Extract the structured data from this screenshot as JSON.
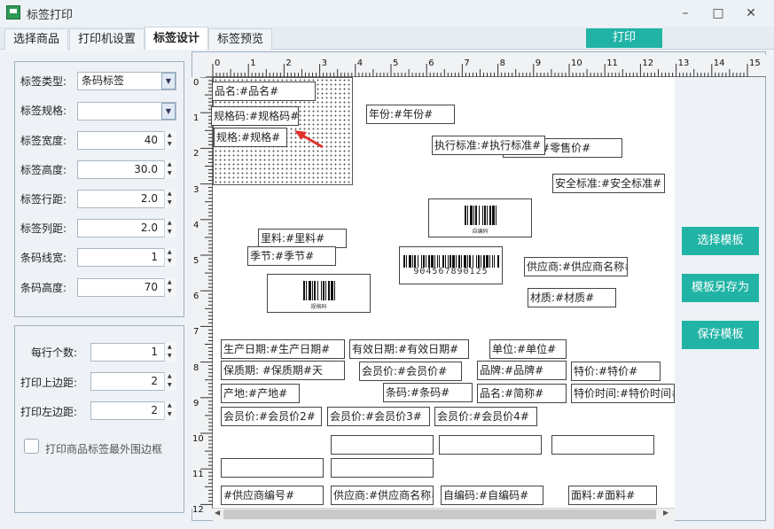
{
  "window": {
    "title": "标签打印",
    "controls": [
      "–",
      "□",
      "✕"
    ]
  },
  "tabs": [
    "选择商品",
    "打印机设置",
    "标签设计",
    "标签预览"
  ],
  "active_tab": 2,
  "print_button": "打印",
  "settings": {
    "label_type": {
      "label": "标签类型:",
      "value": "条码标签"
    },
    "label_spec": {
      "label": "标签规格:",
      "value": ""
    },
    "label_width": {
      "label": "标签宽度:",
      "value": "40"
    },
    "label_height": {
      "label": "标签高度:",
      "value": "30.0"
    },
    "row_gap": {
      "label": "标签行距:",
      "value": "2.0"
    },
    "col_gap": {
      "label": "标签列距:",
      "value": "2.0"
    },
    "bar_width": {
      "label": "条码线宽:",
      "value": "1"
    },
    "bar_height": {
      "label": "条码高度:",
      "value": "70"
    }
  },
  "print_settings": {
    "per_row": {
      "label": "每行个数:",
      "value": "1"
    },
    "top_margin": {
      "label": "打印上边距:",
      "value": "2"
    },
    "left_margin": {
      "label": "打印左边距:",
      "value": "2"
    },
    "border_checkbox": "打印商品标签最外围边框"
  },
  "ruler": {
    "h": [
      "0",
      "1",
      "2",
      "3",
      "4",
      "5",
      "6",
      "7",
      "8",
      "9",
      "10",
      "11",
      "12",
      "13",
      "14",
      "15"
    ],
    "v": [
      "0",
      "1",
      "2",
      "3",
      "4",
      "5",
      "6",
      "7",
      "8",
      "9",
      "10",
      "11",
      "12"
    ]
  },
  "fields": {
    "f1": "品名:#品名#",
    "f2": "规格码:#规格码#",
    "f3": "规格:#规格#",
    "f4": "年份:#年份#",
    "f5": "执行标准:#执行标准#",
    "f6": "零售价:#零售价#",
    "f7": "安全标准:#安全标准#",
    "f8": "里料:#里料#",
    "f9": "季节:#季节#",
    "f10": "供应商:#供应商名称#",
    "f11": "材质:#材质#",
    "f12": "生产日期:#生产日期#",
    "f13": "有效日期:#有效日期#",
    "f14": "单位:#单位#",
    "f15": "保质期: #保质期#天",
    "f16": "会员价:#会员价#",
    "f17": "品牌:#品牌#",
    "f18": "特价:#特价#",
    "f19": "产地:#产地#",
    "f20": "条码:#条码#",
    "f21": "品名:#简称#",
    "f22": "特价时间:#特价时间#",
    "f23": "会员价:#会员价2#",
    "f24": "会员价:#会员价3#",
    "f25": "会员价:#会员价4#",
    "f26": "#供应商编号#",
    "f27": "供应商:#供应商名称#",
    "f28": "自编码:#自编码#",
    "f29": "面料:#面料#"
  },
  "barcodes": {
    "b1": "自编码",
    "b2": "904567890125",
    "b3": "规格码"
  },
  "side_buttons": {
    "choose": "选择模板",
    "save_as": "模板另存为",
    "save": "保存模板"
  },
  "colors": {
    "accent": "#21b4a6",
    "arrow": "#e0332c"
  }
}
